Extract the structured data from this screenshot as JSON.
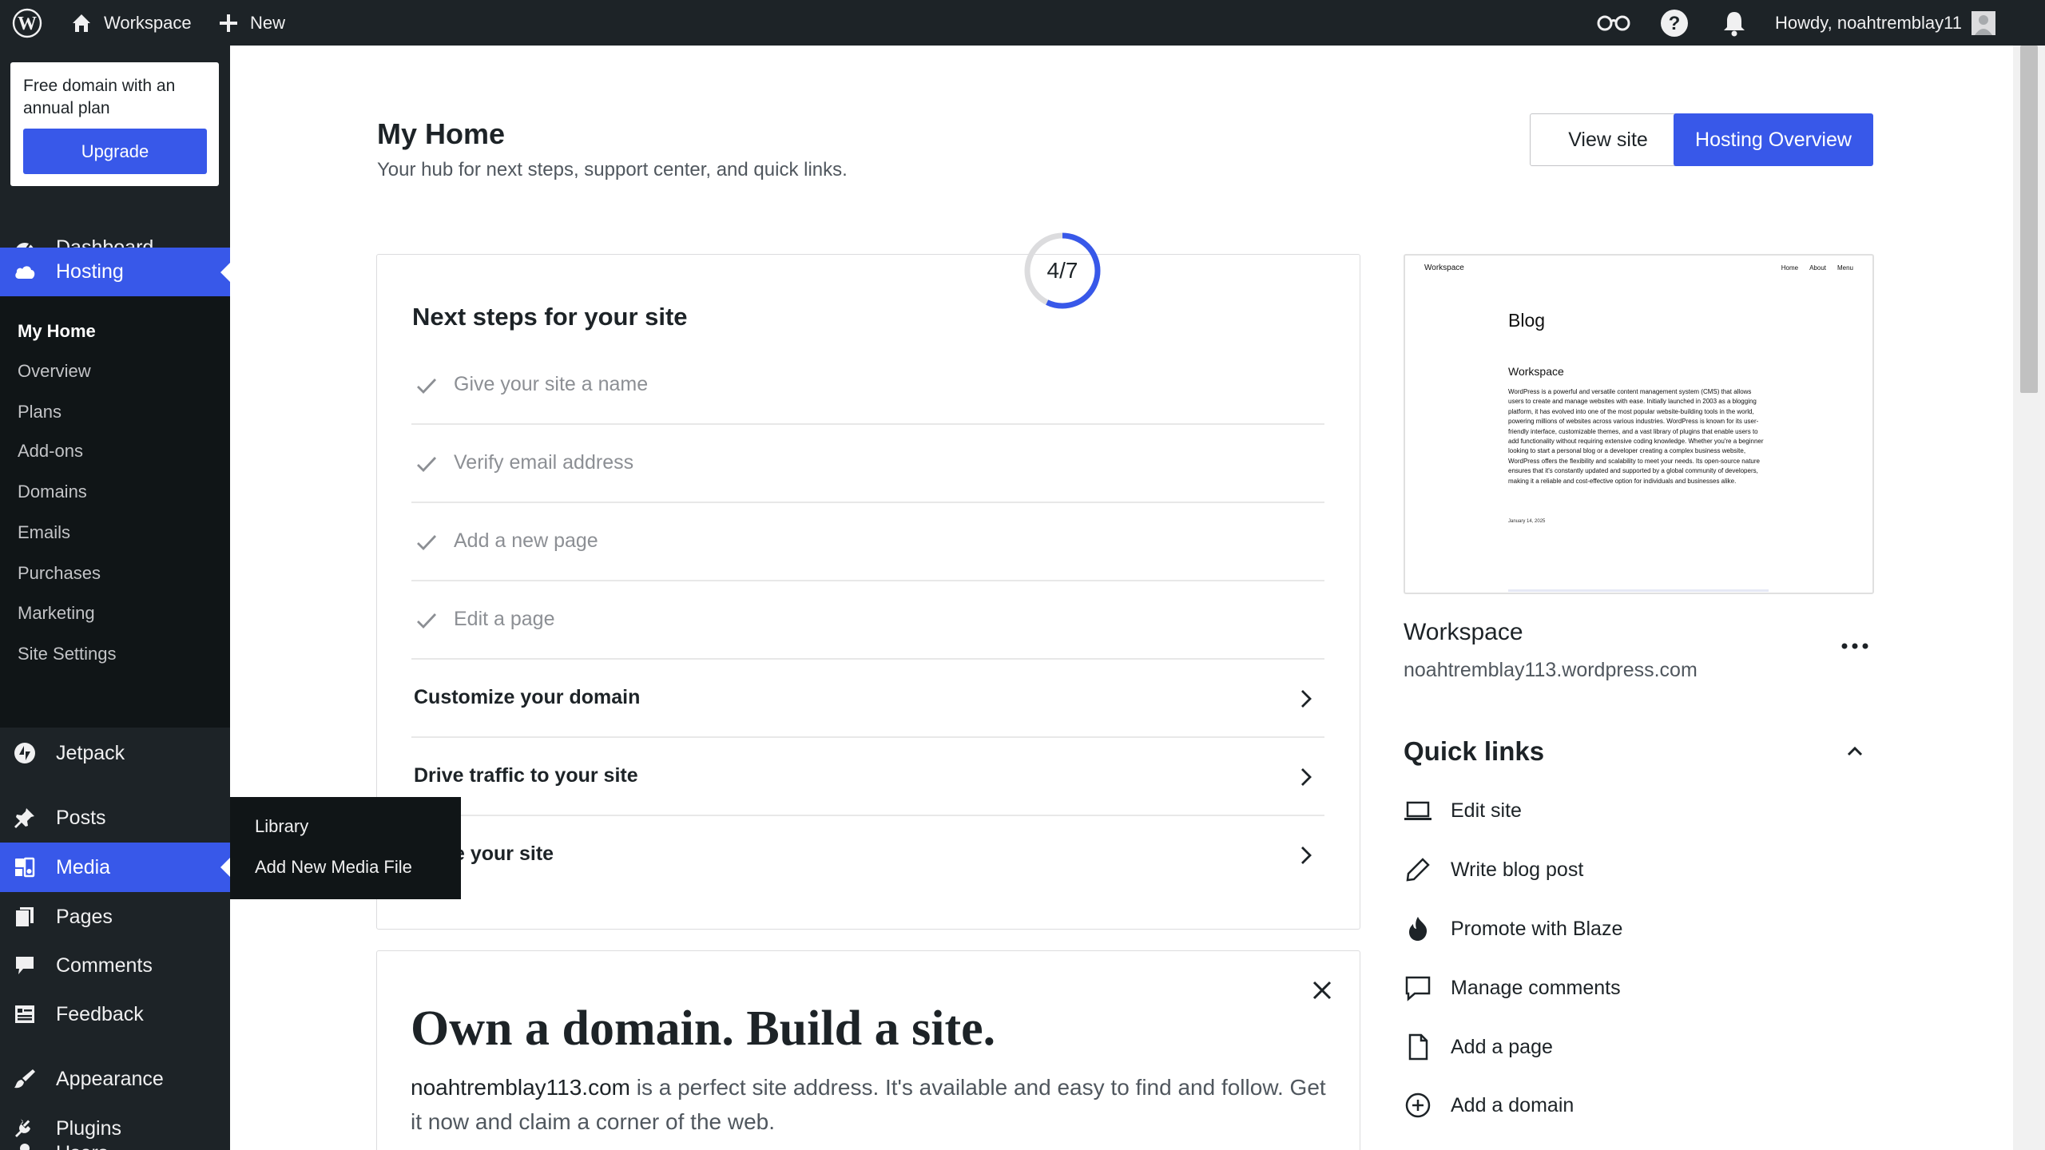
{
  "adminbar": {
    "site_name": "Workspace",
    "new_label": "New",
    "howdy": "Howdy, noahtremblay11"
  },
  "sidebar": {
    "promo_text": "Free domain with an annual plan",
    "upgrade_label": "Upgrade",
    "items": {
      "dashboard": "Dashboard",
      "hosting": "Hosting",
      "jetpack": "Jetpack",
      "posts": "Posts",
      "media": "Media",
      "pages": "Pages",
      "comments": "Comments",
      "feedback": "Feedback",
      "appearance": "Appearance",
      "plugins": "Plugins",
      "users": "Users"
    },
    "hosting_submenu": [
      "My Home",
      "Overview",
      "Plans",
      "Add-ons",
      "Domains",
      "Emails",
      "Purchases",
      "Marketing",
      "Site Settings"
    ],
    "media_flyout": [
      "Library",
      "Add New Media File"
    ]
  },
  "header": {
    "title": "My Home",
    "subtitle": "Your hub for next steps, support center, and quick links.",
    "view_site": "View site",
    "hosting_overview": "Hosting Overview"
  },
  "next_steps": {
    "title": "Next steps for your site",
    "progress_label": "4/7",
    "progress_fraction": 0.5714,
    "completed": [
      "Give your site a name",
      "Verify email address",
      "Add a new page",
      "Edit a page"
    ],
    "open": [
      "Customize your domain",
      "Drive traffic to your site",
      "e your site"
    ]
  },
  "site_card": {
    "preview": {
      "brand": "Workspace",
      "nav": [
        "Home",
        "About",
        "Menu"
      ],
      "heading": "Blog",
      "post_title": "Workspace",
      "post_body": "WordPress is a powerful and versatile content management system (CMS) that allows users to create and manage websites with ease. Initially launched in 2003 as a blogging platform, it has evolved into one of the most popular website-building tools in the world, powering millions of websites across various industries. WordPress is known for its user-friendly interface, customizable themes, and a vast library of plugins that enable users to add functionality without requiring extensive coding knowledge. Whether you're a beginner looking to start a personal blog or a developer creating a complex business website, WordPress offers the flexibility and scalability to meet your needs. Its open-source nature ensures that it's constantly updated and supported by a global community of developers, making it a reliable and cost-effective option for individuals and businesses alike.",
      "date": "January 14, 2025"
    },
    "name": "Workspace",
    "url": "noahtremblay113.wordpress.com"
  },
  "quick_links": {
    "title": "Quick links",
    "items": [
      "Edit site",
      "Write blog post",
      "Promote with Blaze",
      "Manage comments",
      "Add a page",
      "Add a domain"
    ]
  },
  "domain_promo": {
    "title": "Own a domain. Build a site.",
    "domain": "noahtremblay113.com",
    "text": " is a perfect site address. It's available and easy to find and follow. Get it now and claim a corner of the web."
  },
  "colors": {
    "accent": "#3858e9",
    "admin_bg": "#1d2327",
    "submenu_bg": "#101517"
  }
}
